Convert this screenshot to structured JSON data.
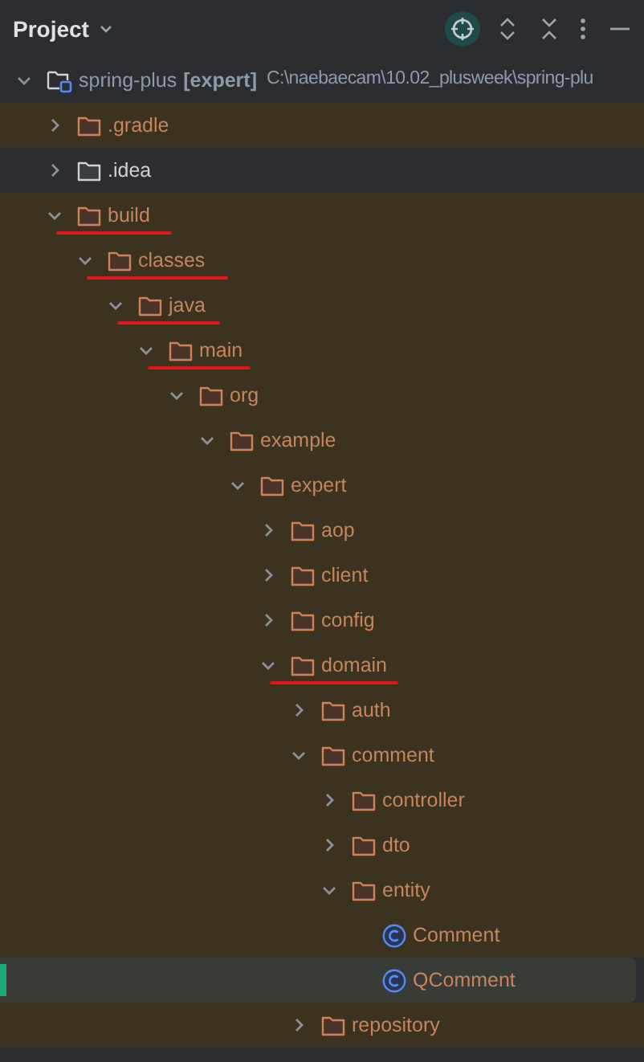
{
  "header": {
    "title": "Project"
  },
  "tree": [
    {
      "kind": "project",
      "name": "spring-plus",
      "module": "[expert]",
      "path": "C:\\naebaecam\\10.02_plusweek\\spring-plu",
      "expanded": true,
      "excluded": false,
      "selected": false,
      "underlined": false,
      "children": [
        {
          "kind": "folder",
          "name": ".gradle",
          "expanded": false,
          "excluded": true,
          "selected": false,
          "underlined": false
        },
        {
          "kind": "folder",
          "name": ".idea",
          "expanded": false,
          "excluded": false,
          "selected": false,
          "underlined": false
        },
        {
          "kind": "folder",
          "name": "build",
          "expanded": true,
          "excluded": true,
          "selected": false,
          "underlined": true,
          "children": [
            {
              "kind": "folder",
              "name": "classes",
              "expanded": true,
              "excluded": true,
              "selected": false,
              "underlined": true,
              "children": [
                {
                  "kind": "folder",
                  "name": "java",
                  "expanded": true,
                  "excluded": true,
                  "selected": false,
                  "underlined": true,
                  "children": [
                    {
                      "kind": "folder",
                      "name": "main",
                      "expanded": true,
                      "excluded": true,
                      "selected": false,
                      "underlined": true,
                      "children": [
                        {
                          "kind": "folder",
                          "name": "org",
                          "expanded": true,
                          "excluded": true,
                          "selected": false,
                          "underlined": false,
                          "children": [
                            {
                              "kind": "folder",
                              "name": "example",
                              "expanded": true,
                              "excluded": true,
                              "selected": false,
                              "underlined": false,
                              "children": [
                                {
                                  "kind": "folder",
                                  "name": "expert",
                                  "expanded": true,
                                  "excluded": true,
                                  "selected": false,
                                  "underlined": false,
                                  "children": [
                                    {
                                      "kind": "folder",
                                      "name": "aop",
                                      "expanded": false,
                                      "excluded": true,
                                      "selected": false,
                                      "underlined": false
                                    },
                                    {
                                      "kind": "folder",
                                      "name": "client",
                                      "expanded": false,
                                      "excluded": true,
                                      "selected": false,
                                      "underlined": false
                                    },
                                    {
                                      "kind": "folder",
                                      "name": "config",
                                      "expanded": false,
                                      "excluded": true,
                                      "selected": false,
                                      "underlined": false
                                    },
                                    {
                                      "kind": "folder",
                                      "name": "domain",
                                      "expanded": true,
                                      "excluded": true,
                                      "selected": false,
                                      "underlined": true,
                                      "children": [
                                        {
                                          "kind": "folder",
                                          "name": "auth",
                                          "expanded": false,
                                          "excluded": true,
                                          "selected": false,
                                          "underlined": false
                                        },
                                        {
                                          "kind": "folder",
                                          "name": "comment",
                                          "expanded": true,
                                          "excluded": true,
                                          "selected": false,
                                          "underlined": false,
                                          "children": [
                                            {
                                              "kind": "folder",
                                              "name": "controller",
                                              "expanded": false,
                                              "excluded": true,
                                              "selected": false,
                                              "underlined": false
                                            },
                                            {
                                              "kind": "folder",
                                              "name": "dto",
                                              "expanded": false,
                                              "excluded": true,
                                              "selected": false,
                                              "underlined": false
                                            },
                                            {
                                              "kind": "folder",
                                              "name": "entity",
                                              "expanded": true,
                                              "excluded": true,
                                              "selected": false,
                                              "underlined": false,
                                              "children": [
                                                {
                                                  "kind": "class",
                                                  "name": "Comment",
                                                  "excluded": true,
                                                  "selected": false,
                                                  "underlined": false
                                                },
                                                {
                                                  "kind": "class",
                                                  "name": "QComment",
                                                  "excluded": true,
                                                  "selected": true,
                                                  "underlined": false
                                                }
                                              ]
                                            }
                                          ]
                                        },
                                        {
                                          "kind": "folder",
                                          "name": "repository",
                                          "expanded": false,
                                          "excluded": true,
                                          "selected": false,
                                          "underlined": false
                                        }
                                      ]
                                    }
                                  ]
                                }
                              ]
                            }
                          ]
                        }
                      ]
                    }
                  ]
                }
              ]
            }
          ]
        }
      ]
    }
  ]
}
